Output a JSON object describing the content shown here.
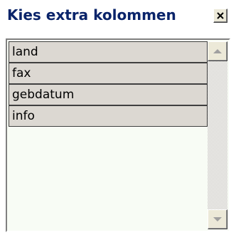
{
  "window": {
    "title": "Kies extra kolommen",
    "title_color": "#0a246a"
  },
  "list": {
    "items": [
      {
        "label": "land"
      },
      {
        "label": "fax"
      },
      {
        "label": "gebdatum"
      },
      {
        "label": "info"
      }
    ],
    "item_background": "#dcd8d2",
    "background": "#f8fcf5"
  },
  "icons": {
    "close": "close-x-icon",
    "scroll_up": "arrow-up-icon",
    "scroll_down": "arrow-down-icon"
  }
}
